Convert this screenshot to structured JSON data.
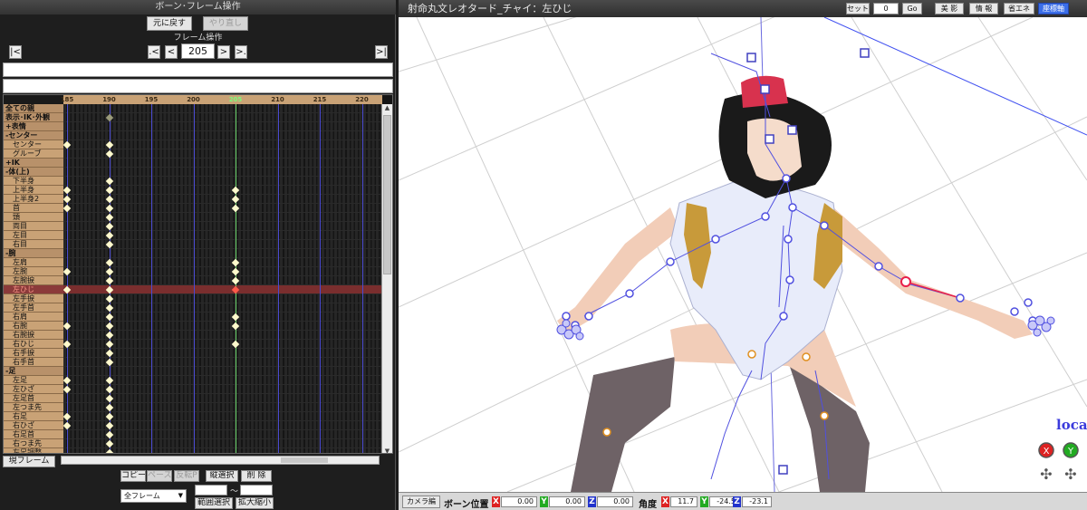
{
  "left_panel": {
    "title": "ボーン･フレーム操作",
    "undo_label": "元に戻す",
    "redo_label": "やり直し",
    "frame_op_label": "フレーム操作",
    "current_frame": "205",
    "first_label": "|<",
    "prev_key_label": ".<",
    "prev_label": "<",
    "next_label": ">",
    "next_key_label": ">.",
    "last_label": ">|",
    "ruler_ticks": [
      "185",
      "190",
      "195",
      "200",
      "205",
      "210",
      "215",
      "220"
    ],
    "current_tick": "205",
    "bones": [
      {
        "label": "全ての親",
        "group": true,
        "keys": []
      },
      {
        "label": "表示･IK･外観",
        "group": true,
        "keys": [
          {
            "f": 190,
            "t": "gray"
          }
        ]
      },
      {
        "label": "+表情",
        "group": true,
        "keys": []
      },
      {
        "label": "-センター",
        "group": true,
        "keys": []
      },
      {
        "label": "センター",
        "keys": [
          {
            "f": 185
          },
          {
            "f": 190
          }
        ]
      },
      {
        "label": "グルーブ",
        "keys": [
          {
            "f": 190
          }
        ]
      },
      {
        "label": "+IK",
        "group": true,
        "keys": []
      },
      {
        "label": "-体(上)",
        "group": true,
        "keys": []
      },
      {
        "label": "下半身",
        "keys": [
          {
            "f": 190
          }
        ]
      },
      {
        "label": "上半身",
        "keys": [
          {
            "f": 185
          },
          {
            "f": 190
          },
          {
            "f": 205
          }
        ]
      },
      {
        "label": "上半身2",
        "keys": [
          {
            "f": 185
          },
          {
            "f": 190
          },
          {
            "f": 205
          }
        ]
      },
      {
        "label": "首",
        "keys": [
          {
            "f": 185
          },
          {
            "f": 190
          },
          {
            "f": 205
          }
        ]
      },
      {
        "label": "頭",
        "keys": [
          {
            "f": 190
          }
        ]
      },
      {
        "label": "両目",
        "keys": [
          {
            "f": 190
          }
        ]
      },
      {
        "label": "左目",
        "keys": [
          {
            "f": 190
          }
        ]
      },
      {
        "label": "右目",
        "keys": [
          {
            "f": 190
          }
        ]
      },
      {
        "label": "-腕",
        "group": true,
        "keys": []
      },
      {
        "label": "左肩",
        "keys": [
          {
            "f": 190
          },
          {
            "f": 205
          }
        ]
      },
      {
        "label": "左腕",
        "keys": [
          {
            "f": 185
          },
          {
            "f": 190
          },
          {
            "f": 205
          }
        ]
      },
      {
        "label": "左腕捩",
        "keys": [
          {
            "f": 190
          },
          {
            "f": 205
          }
        ]
      },
      {
        "label": "左ひじ",
        "sel": true,
        "keys": [
          {
            "f": 185
          },
          {
            "f": 190
          },
          {
            "f": 205,
            "t": "red"
          }
        ]
      },
      {
        "label": "左手捩",
        "keys": [
          {
            "f": 190
          }
        ]
      },
      {
        "label": "左手首",
        "keys": [
          {
            "f": 190
          }
        ]
      },
      {
        "label": "右肩",
        "keys": [
          {
            "f": 190
          },
          {
            "f": 205
          }
        ]
      },
      {
        "label": "右腕",
        "keys": [
          {
            "f": 185
          },
          {
            "f": 190
          },
          {
            "f": 205
          }
        ]
      },
      {
        "label": "右腕捩",
        "keys": [
          {
            "f": 190
          }
        ]
      },
      {
        "label": "右ひじ",
        "keys": [
          {
            "f": 185
          },
          {
            "f": 190
          },
          {
            "f": 205
          }
        ]
      },
      {
        "label": "右手捩",
        "keys": [
          {
            "f": 190
          }
        ]
      },
      {
        "label": "右手首",
        "keys": [
          {
            "f": 190
          }
        ]
      },
      {
        "label": "-足",
        "group": true,
        "keys": []
      },
      {
        "label": "左足",
        "keys": [
          {
            "f": 185
          },
          {
            "f": 190
          }
        ]
      },
      {
        "label": "左ひざ",
        "keys": [
          {
            "f": 185
          },
          {
            "f": 190
          }
        ]
      },
      {
        "label": "左足首",
        "keys": [
          {
            "f": 190
          }
        ]
      },
      {
        "label": "左つま先",
        "keys": [
          {
            "f": 190
          }
        ]
      },
      {
        "label": "右足",
        "keys": [
          {
            "f": 185
          },
          {
            "f": 190
          }
        ]
      },
      {
        "label": "右ひざ",
        "keys": [
          {
            "f": 185
          },
          {
            "f": 190
          }
        ]
      },
      {
        "label": "右足首",
        "keys": [
          {
            "f": 190
          }
        ]
      },
      {
        "label": "右つま先",
        "keys": [
          {
            "f": 190
          }
        ]
      },
      {
        "label": "左足調整",
        "keys": [
          {
            "f": 190
          }
        ]
      }
    ],
    "current_frame_button": "現フレーム",
    "copy_label": "コピー",
    "paste_label": "ペースト",
    "reverse_label": "反転P",
    "vert_select_label": "縦選択",
    "delete_label": "削 除",
    "all_frames_label": "全フレーム",
    "range_tilde": "～",
    "range_select_label": "範囲選択",
    "scale_label": "拡大縮小"
  },
  "viewport": {
    "title": "射命丸文レオタード_チャイ：左ひじ",
    "set_label": "セット",
    "set_value": "0",
    "go_label": "Go",
    "shadow_label": "影",
    "shadow_prefix": "美",
    "info_label": "情 報",
    "eco_label": "省エネ",
    "axis_label": "座標軸",
    "local_label": "local",
    "camera_label": "カメラ編",
    "bone_pos_label": "ボーン位置",
    "pos": {
      "x": "0.00",
      "y": "0.00",
      "z": "0.00"
    },
    "angle_label": "角度",
    "angle": {
      "x": "11.7",
      "y": "-24.5",
      "z": "-23.1"
    },
    "axis_x": "X",
    "axis_y": "Y",
    "axis_z": "Z"
  },
  "colors": {
    "bone_line": "#4a4ad0",
    "bone_selected": "#e8204a",
    "frame_marker": "#68d068"
  }
}
